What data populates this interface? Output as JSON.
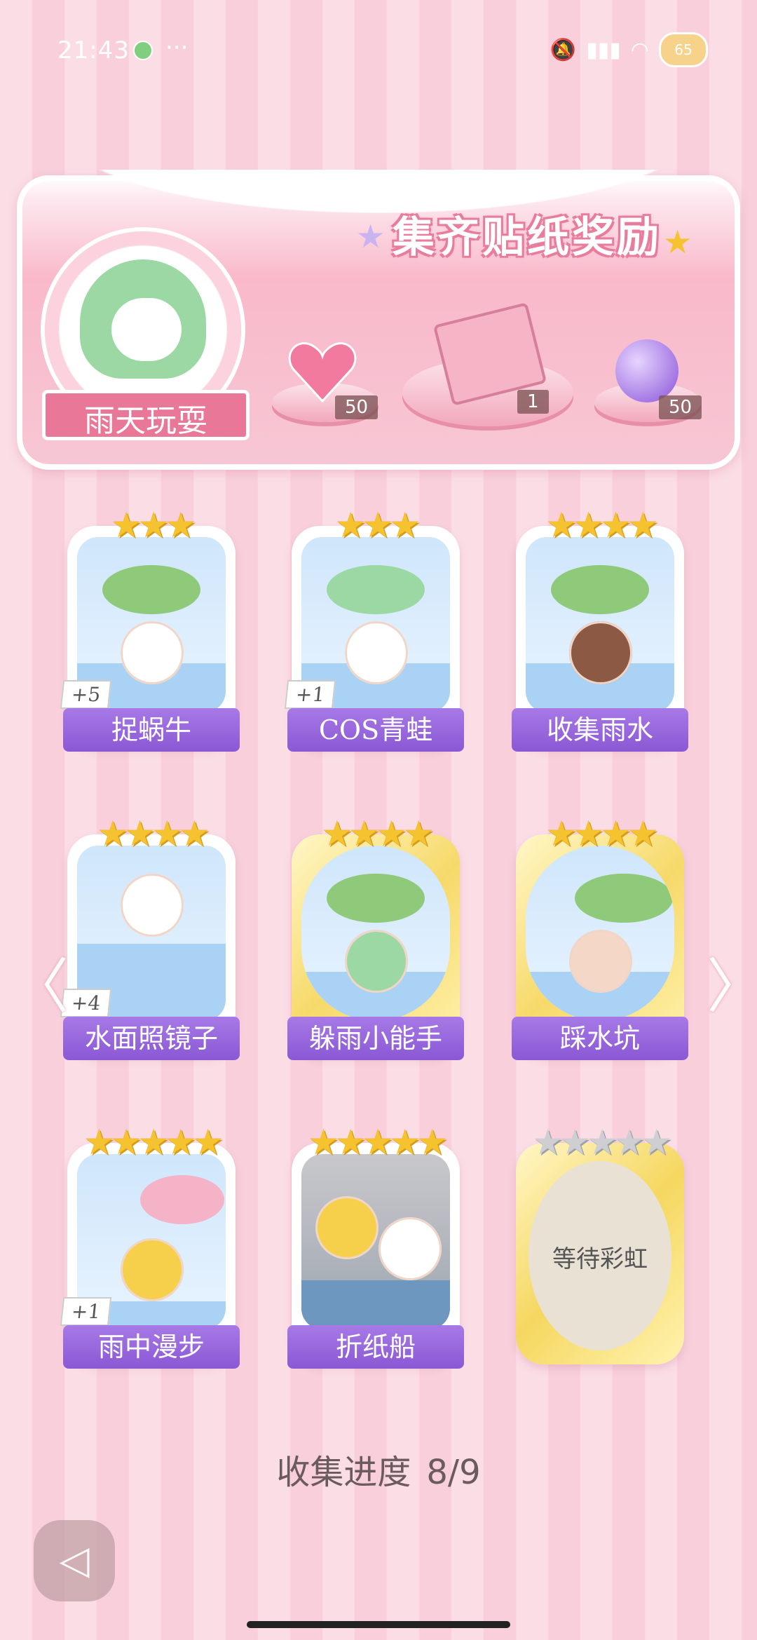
{
  "status": {
    "time": "21:43",
    "battery": "65",
    "more": "···"
  },
  "banner": {
    "title": "集齐贴纸奖励",
    "avatar_label": "雨天玩耍",
    "rewards": [
      {
        "icon": "heart-gem-icon",
        "count": "50"
      },
      {
        "icon": "gift-box-icon",
        "count": "1"
      },
      {
        "icon": "energy-orb-icon",
        "count": "50"
      }
    ]
  },
  "cards": [
    {
      "label": "捉蜗牛",
      "stars": "★★★",
      "bonus": "+5"
    },
    {
      "label": "COS青蛙",
      "stars": "★★★",
      "bonus": "+1"
    },
    {
      "label": "收集雨水",
      "stars": "★★★★",
      "bonus": ""
    },
    {
      "label": "水面照镜子",
      "stars": "★★★★",
      "bonus": "+4"
    },
    {
      "label": "躲雨小能手",
      "stars": "★★★★",
      "bonus": ""
    },
    {
      "label": "踩水坑",
      "stars": "★★★★",
      "bonus": ""
    },
    {
      "label": "雨中漫步",
      "stars": "★★★★★",
      "bonus": "+1"
    },
    {
      "label": "折纸船",
      "stars": "★★★★★",
      "bonus": ""
    },
    {
      "label": "等待彩虹",
      "stars": "★★★★★",
      "bonus": ""
    }
  ],
  "progress": {
    "label": "收集进度",
    "value": "8/9"
  },
  "nav": {
    "prev": "〈",
    "next": "〉"
  }
}
